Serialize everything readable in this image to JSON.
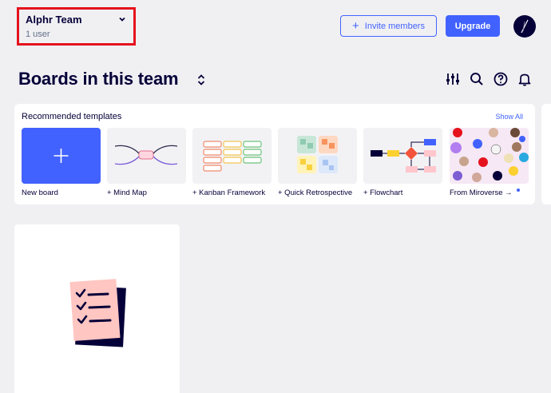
{
  "team": {
    "name": "Alphr Team",
    "users": "1 user"
  },
  "header": {
    "invite_label": "Invite members",
    "upgrade_label": "Upgrade"
  },
  "page": {
    "title": "Boards in this team"
  },
  "templates": {
    "title": "Recommended templates",
    "show_all": "Show All",
    "items": [
      {
        "label": "New board"
      },
      {
        "label": "+ Mind Map"
      },
      {
        "label": "+ Kanban Framework"
      },
      {
        "label": "+ Quick Retrospective"
      },
      {
        "label": "+ Flowchart"
      },
      {
        "label": "From Miroverse →"
      }
    ]
  },
  "colors": {
    "accent": "#4262ff",
    "ink": "#050038",
    "highlight_box": "#e5121d",
    "background": "#f0f0f3"
  },
  "icons": [
    "chevron-down-icon",
    "plus-icon",
    "sort-icon",
    "filter-sliders-icon",
    "search-icon",
    "help-icon",
    "bell-icon",
    "checklist-icon"
  ]
}
